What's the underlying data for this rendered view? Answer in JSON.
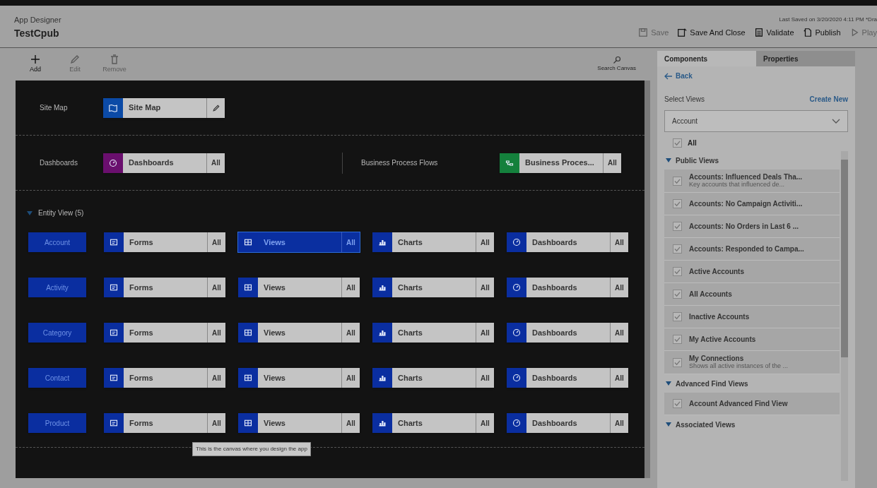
{
  "header": {
    "app_label": "App Designer",
    "app_name": "TestCpub",
    "last_saved": "Last Saved on 3/20/2020 4:11 PM *Dra",
    "actions": [
      {
        "kind": "save",
        "label": "Save",
        "disabled": true
      },
      {
        "kind": "saveclose",
        "label": "Save And Close",
        "disabled": false
      },
      {
        "kind": "validate",
        "label": "Validate",
        "disabled": false
      },
      {
        "kind": "publish",
        "label": "Publish",
        "disabled": false
      },
      {
        "kind": "play",
        "label": "Play",
        "disabled": true
      }
    ]
  },
  "toolbar": {
    "items": [
      {
        "kind": "add",
        "label": "Add",
        "disabled": false
      },
      {
        "kind": "edit",
        "label": "Edit",
        "disabled": true
      },
      {
        "kind": "remove",
        "label": "Remove",
        "disabled": true
      }
    ],
    "search": "Search Canvas"
  },
  "canvas": {
    "site_map": {
      "label": "Site Map",
      "tile": {
        "kind": "sitemap",
        "label": "Site Map",
        "color": "#0b4aa6"
      }
    },
    "dashboards": {
      "label": "Dashboards",
      "tile": {
        "kind": "dashboards",
        "label": "Dashboards",
        "action": "All",
        "color": "#6a0f6e"
      }
    },
    "bpf": {
      "label": "Business Process Flows",
      "tile": {
        "kind": "bpf",
        "label": "Business Proces...",
        "action": "All",
        "color": "#14803c"
      }
    },
    "entity_view": {
      "label": "Entity View (5)",
      "expanded": true,
      "entities": [
        {
          "name": "Account",
          "tiles": [
            {
              "kind": "forms",
              "label": "Forms",
              "action": "All",
              "selected": false
            },
            {
              "kind": "views",
              "label": "Views",
              "action": "All",
              "selected": true
            },
            {
              "kind": "charts",
              "label": "Charts",
              "action": "All",
              "selected": false
            },
            {
              "kind": "dashboards",
              "label": "Dashboards",
              "action": "All",
              "selected": false
            }
          ]
        },
        {
          "name": "Activity",
          "tiles": [
            {
              "kind": "forms",
              "label": "Forms",
              "action": "All",
              "selected": false
            },
            {
              "kind": "views",
              "label": "Views",
              "action": "All",
              "selected": false
            },
            {
              "kind": "charts",
              "label": "Charts",
              "action": "All",
              "selected": false
            },
            {
              "kind": "dashboards",
              "label": "Dashboards",
              "action": "All",
              "selected": false
            }
          ]
        },
        {
          "name": "Category",
          "tiles": [
            {
              "kind": "forms",
              "label": "Forms",
              "action": "All",
              "selected": false
            },
            {
              "kind": "views",
              "label": "Views",
              "action": "All",
              "selected": false
            },
            {
              "kind": "charts",
              "label": "Charts",
              "action": "All",
              "selected": false
            },
            {
              "kind": "dashboards",
              "label": "Dashboards",
              "action": "All",
              "selected": false
            }
          ]
        },
        {
          "name": "Contact",
          "tiles": [
            {
              "kind": "forms",
              "label": "Forms",
              "action": "All",
              "selected": false
            },
            {
              "kind": "views",
              "label": "Views",
              "action": "All",
              "selected": false
            },
            {
              "kind": "charts",
              "label": "Charts",
              "action": "All",
              "selected": false
            },
            {
              "kind": "dashboards",
              "label": "Dashboards",
              "action": "All",
              "selected": false
            }
          ]
        },
        {
          "name": "Product",
          "tiles": [
            {
              "kind": "forms",
              "label": "Forms",
              "action": "All",
              "selected": false
            },
            {
              "kind": "views",
              "label": "Views",
              "action": "All",
              "selected": false
            },
            {
              "kind": "charts",
              "label": "Charts",
              "action": "All",
              "selected": false
            },
            {
              "kind": "dashboards",
              "label": "Dashboards",
              "action": "All",
              "selected": false
            }
          ]
        }
      ]
    },
    "tooltip": "This is the canvas where you design the app"
  },
  "panel": {
    "tabs": [
      {
        "label": "Components",
        "selected": true
      },
      {
        "label": "Properties",
        "selected": false
      }
    ],
    "back": "Back",
    "select_label": "Select Views",
    "create_new": "Create New",
    "entity_select": "Account",
    "all": {
      "label": "All",
      "checked": true
    },
    "groups": [
      {
        "label": "Public Views",
        "expanded": true,
        "items": [
          {
            "title": "Accounts: Influenced Deals Tha...",
            "description": "Key accounts that influenced de...",
            "checked": true
          },
          {
            "title": "Accounts: No Campaign Activiti...",
            "checked": true
          },
          {
            "title": "Accounts: No Orders in Last 6 ...",
            "checked": true
          },
          {
            "title": "Accounts: Responded to Campa...",
            "checked": true
          },
          {
            "title": "Active Accounts",
            "checked": true
          },
          {
            "title": "All Accounts",
            "checked": true
          },
          {
            "title": "Inactive Accounts",
            "checked": true
          },
          {
            "title": "My Active Accounts",
            "checked": true
          },
          {
            "title": "My Connections",
            "description": "Shows all active instances of the ...",
            "checked": true
          }
        ]
      },
      {
        "label": "Advanced Find Views",
        "expanded": true,
        "items": [
          {
            "title": "Account Advanced Find View",
            "checked": true
          }
        ]
      },
      {
        "label": "Associated Views",
        "expanded": true
      }
    ]
  }
}
